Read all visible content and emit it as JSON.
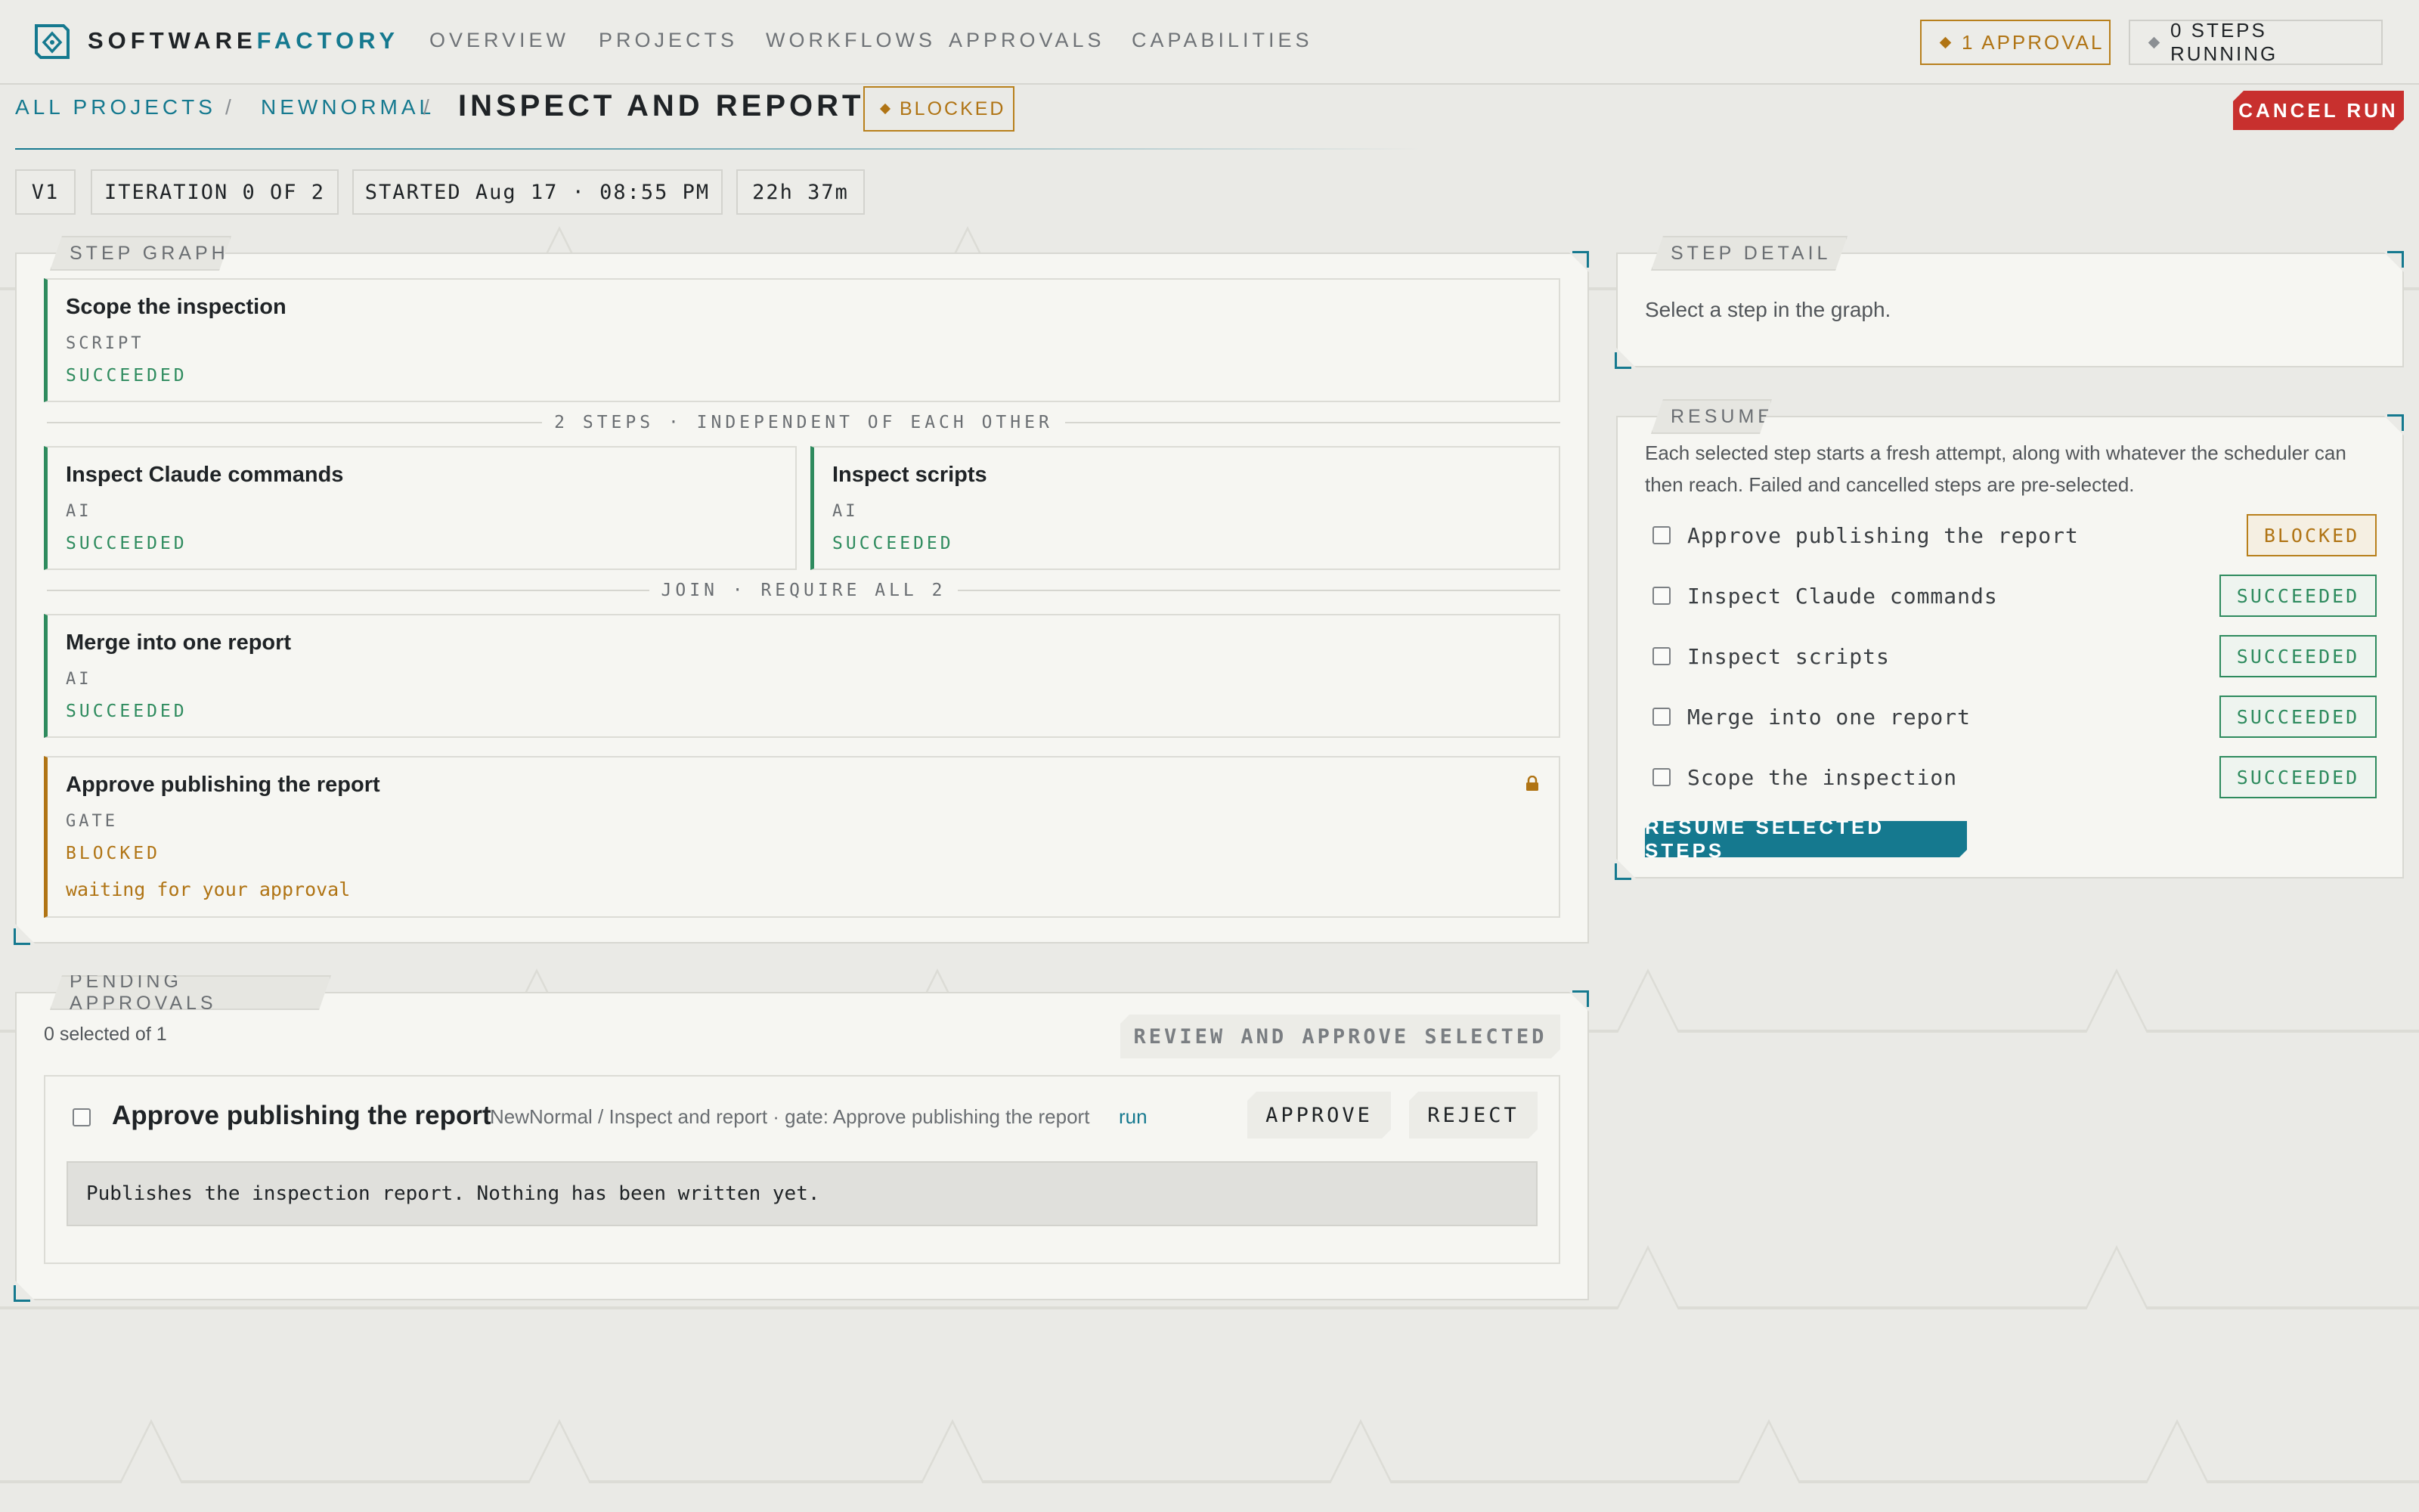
{
  "nav": {
    "brand_a": "SOFTWARE",
    "brand_b": "FACTORY",
    "links": [
      "OVERVIEW",
      "PROJECTS",
      "WORKFLOWS",
      "APPROVALS",
      "CAPABILITIES"
    ],
    "approval_pill": "1 APPROVAL",
    "steps_pill": "0 STEPS RUNNING"
  },
  "breadcrumb": {
    "all_projects": "ALL PROJECTS",
    "project": "NEWNORMAL",
    "sep": "/",
    "title": "INSPECT AND REPORT",
    "status": "BLOCKED",
    "cancel": "CANCEL RUN"
  },
  "meta": {
    "version": "V1",
    "iteration": "ITERATION 0 OF 2",
    "started": "STARTED Aug 17 · 08:55 PM",
    "duration": "22h 37m"
  },
  "graph": {
    "tab": "STEP GRAPH",
    "parallel_label": "2 STEPS · INDEPENDENT OF EACH OTHER",
    "join_label": "JOIN · REQUIRE ALL 2",
    "steps": [
      {
        "name": "Scope the inspection",
        "type": "SCRIPT",
        "status": "SUCCEEDED"
      },
      {
        "name": "Inspect Claude commands",
        "type": "AI",
        "status": "SUCCEEDED"
      },
      {
        "name": "Inspect scripts",
        "type": "AI",
        "status": "SUCCEEDED"
      },
      {
        "name": "Merge into one report",
        "type": "AI",
        "status": "SUCCEEDED"
      },
      {
        "name": "Approve publishing the report",
        "type": "GATE",
        "status": "BLOCKED",
        "note": "waiting for your approval"
      }
    ]
  },
  "detail": {
    "tab": "STEP DETAIL",
    "empty": "Select a step in the graph."
  },
  "resume": {
    "tab": "RESUME",
    "desc_1": "Each selected step starts a fresh attempt, along with whatever the scheduler can",
    "desc_2": "then reach. Failed and cancelled steps are pre-selected.",
    "items": [
      {
        "label": "Approve publishing the report",
        "status": "BLOCKED"
      },
      {
        "label": "Inspect Claude commands",
        "status": "SUCCEEDED"
      },
      {
        "label": "Inspect scripts",
        "status": "SUCCEEDED"
      },
      {
        "label": "Merge into one report",
        "status": "SUCCEEDED"
      },
      {
        "label": "Scope the inspection",
        "status": "SUCCEEDED"
      }
    ],
    "button": "RESUME SELECTED STEPS"
  },
  "approvals": {
    "tab": "PENDING APPROVALS",
    "selected_count": "0 selected of 1",
    "review_button": "REVIEW AND APPROVE SELECTED",
    "item": {
      "title": "Approve publishing the report",
      "context": "NewNormal / Inspect and report · gate: Approve publishing the report",
      "run_link": "run",
      "approve": "APPROVE",
      "reject": "REJECT",
      "body": "Publishes the inspection report. Nothing has been written yet."
    }
  },
  "colors": {
    "accent": "#15798f",
    "success": "#2e8b5e",
    "warning": "#b07414",
    "danger": "#c8302e"
  },
  "icons": [
    "logo-icon",
    "diamond-icon",
    "lock-icon",
    "checkbox-icon"
  ]
}
